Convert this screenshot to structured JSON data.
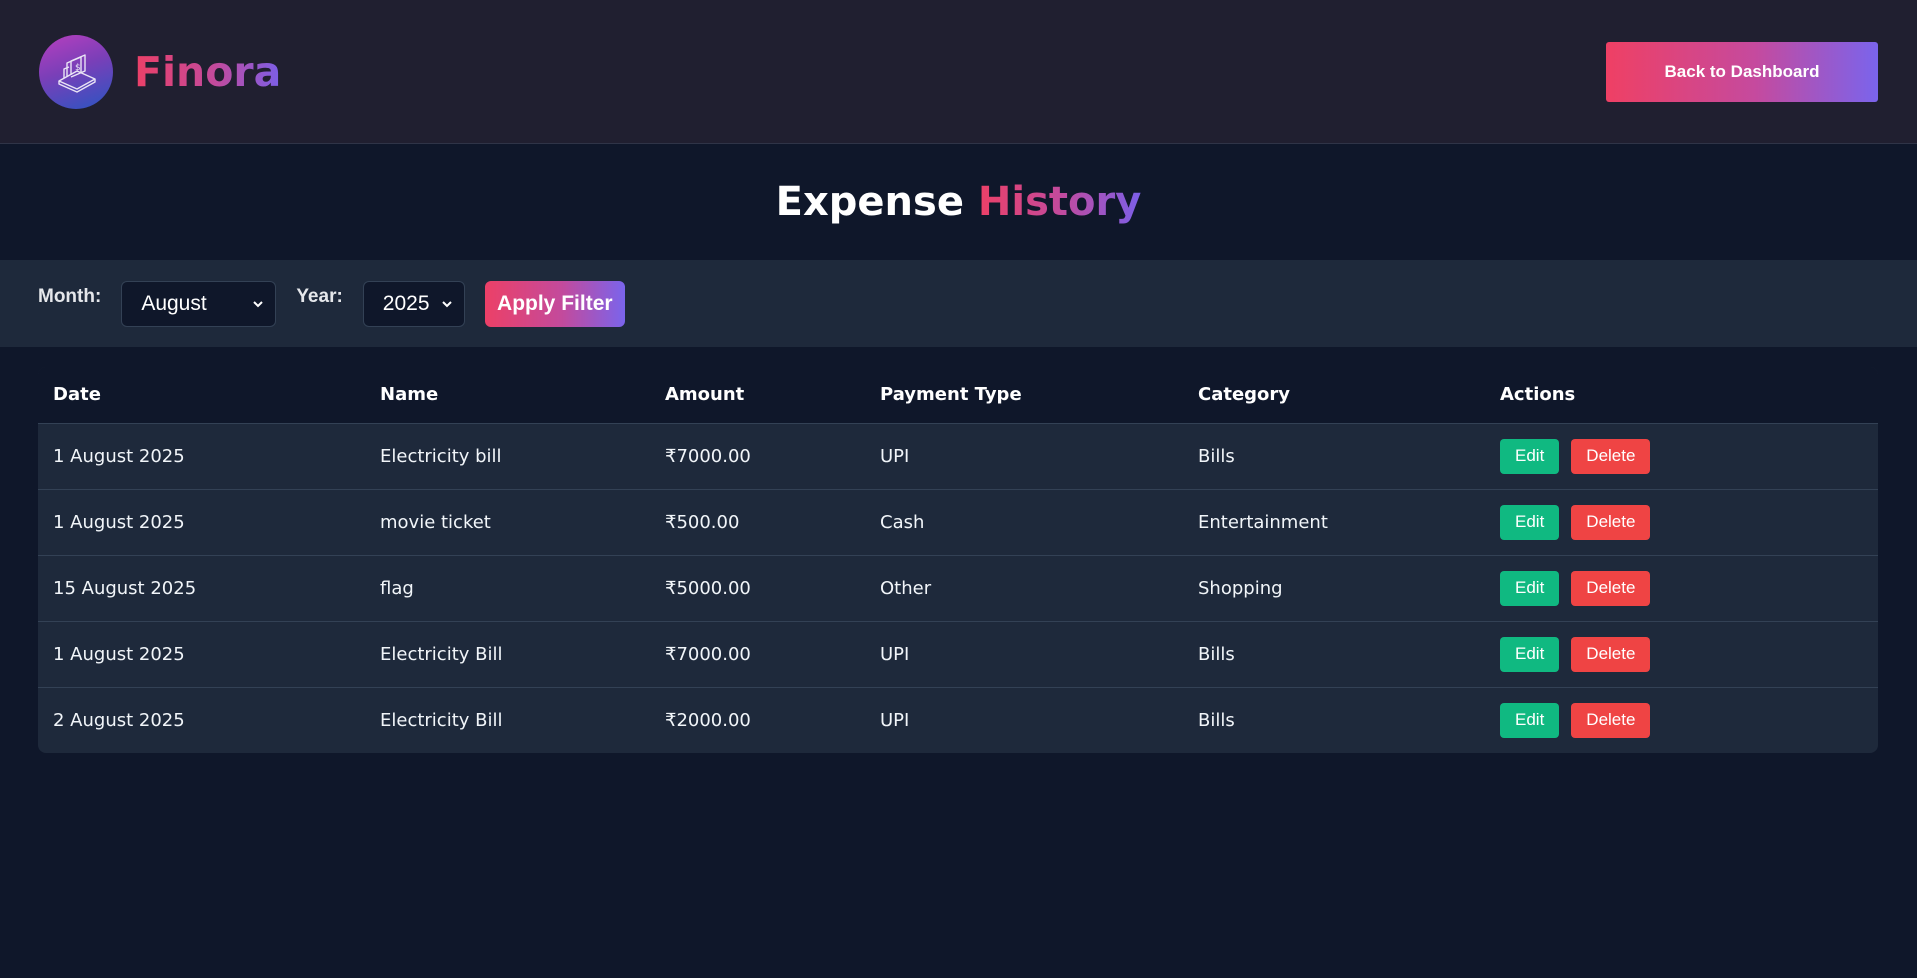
{
  "header": {
    "brand_name": "Finora",
    "logo_icon": "cash-register-icon",
    "back_button_label": "Back to Dashboard"
  },
  "page": {
    "title_main": "Expense",
    "title_accent": "History"
  },
  "filters": {
    "month_label": "Month:",
    "month_value": "August",
    "year_label": "Year:",
    "year_value": "2025",
    "apply_label": "Apply Filter"
  },
  "table": {
    "columns": [
      "Date",
      "Name",
      "Amount",
      "Payment Type",
      "Category",
      "Actions"
    ],
    "rows": [
      {
        "date": "1 August 2025",
        "name": "Electricity bill",
        "amount": "₹7000.00",
        "payment_type": "UPI",
        "category": "Bills",
        "edit": "Edit",
        "delete": "Delete"
      },
      {
        "date": "1 August 2025",
        "name": "movie ticket",
        "amount": "₹500.00",
        "payment_type": "Cash",
        "category": "Entertainment",
        "edit": "Edit",
        "delete": "Delete"
      },
      {
        "date": "15 August 2025",
        "name": "flag",
        "amount": "₹5000.00",
        "payment_type": "Other",
        "category": "Shopping",
        "edit": "Edit",
        "delete": "Delete"
      },
      {
        "date": "1 August 2025",
        "name": "Electricity Bill",
        "amount": "₹7000.00",
        "payment_type": "UPI",
        "category": "Bills",
        "edit": "Edit",
        "delete": "Delete"
      },
      {
        "date": "2 August 2025",
        "name": "Electricity Bill",
        "amount": "₹2000.00",
        "payment_type": "UPI",
        "category": "Bills",
        "edit": "Edit",
        "delete": "Delete"
      }
    ]
  },
  "colors": {
    "background": "#0f172a",
    "header_bg": "#201f30",
    "filter_bg": "#1e293b",
    "edit_green": "#10b981",
    "delete_red": "#ef4444",
    "gradient_start": "#ec4067",
    "gradient_end": "#7b5fe8"
  }
}
